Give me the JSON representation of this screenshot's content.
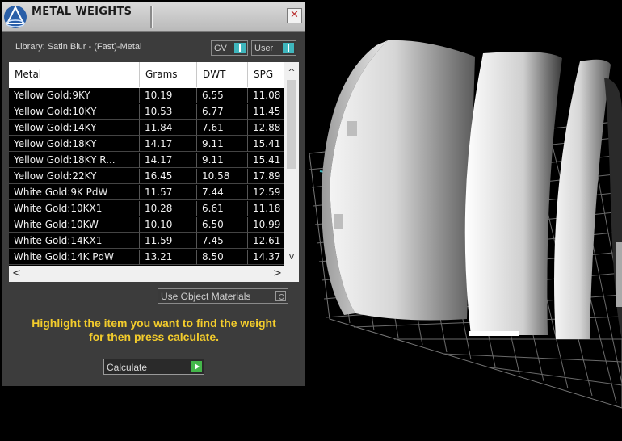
{
  "panel": {
    "title": "METAL WEIGHTS",
    "close_glyph": "✕",
    "library_label": "Library: Satin Blur - (Fast)-Metal",
    "toggles": [
      {
        "label": "GV",
        "state": "on"
      },
      {
        "label": "User",
        "state": "on"
      }
    ],
    "use_object_materials_label": "Use Object Materials",
    "hint_line1": "Highlight the item you want to find the weight",
    "hint_line2": "for then press calculate.",
    "calculate_label": "Calculate",
    "accent_color": "#3fb6bd",
    "hint_color": "#f3cc2c",
    "calculate_arrow_color": "#44b74a"
  },
  "table": {
    "columns": [
      "Metal",
      "Grams",
      "DWT",
      "SPG"
    ],
    "rows": [
      [
        "Yellow Gold:9KY",
        "10.19",
        "6.55",
        "11.08"
      ],
      [
        "Yellow Gold:10KY",
        "10.53",
        "6.77",
        "11.45"
      ],
      [
        "Yellow Gold:14KY",
        "11.84",
        "7.61",
        "12.88"
      ],
      [
        "Yellow Gold:18KY",
        "14.17",
        "9.11",
        "15.41"
      ],
      [
        "Yellow Gold:18KY R...",
        "14.17",
        "9.11",
        "15.41"
      ],
      [
        "Yellow Gold:22KY",
        "16.45",
        "10.58",
        "17.89"
      ],
      [
        "White Gold:9K PdW",
        "11.57",
        "7.44",
        "12.59"
      ],
      [
        "White Gold:10KX1",
        "10.28",
        "6.61",
        "11.18"
      ],
      [
        "White Gold:10KW",
        "10.10",
        "6.50",
        "10.99"
      ],
      [
        "White Gold:14KX1",
        "11.59",
        "7.45",
        "12.61"
      ],
      [
        "White Gold:14K PdW",
        "13.21",
        "8.50",
        "14.37"
      ]
    ],
    "scroll": {
      "up": "^",
      "down": "v",
      "left": "<",
      "right": ">"
    }
  },
  "icons": {
    "title": "app-logo-icon",
    "close": "close-icon",
    "calculate": "play-arrow-icon"
  }
}
